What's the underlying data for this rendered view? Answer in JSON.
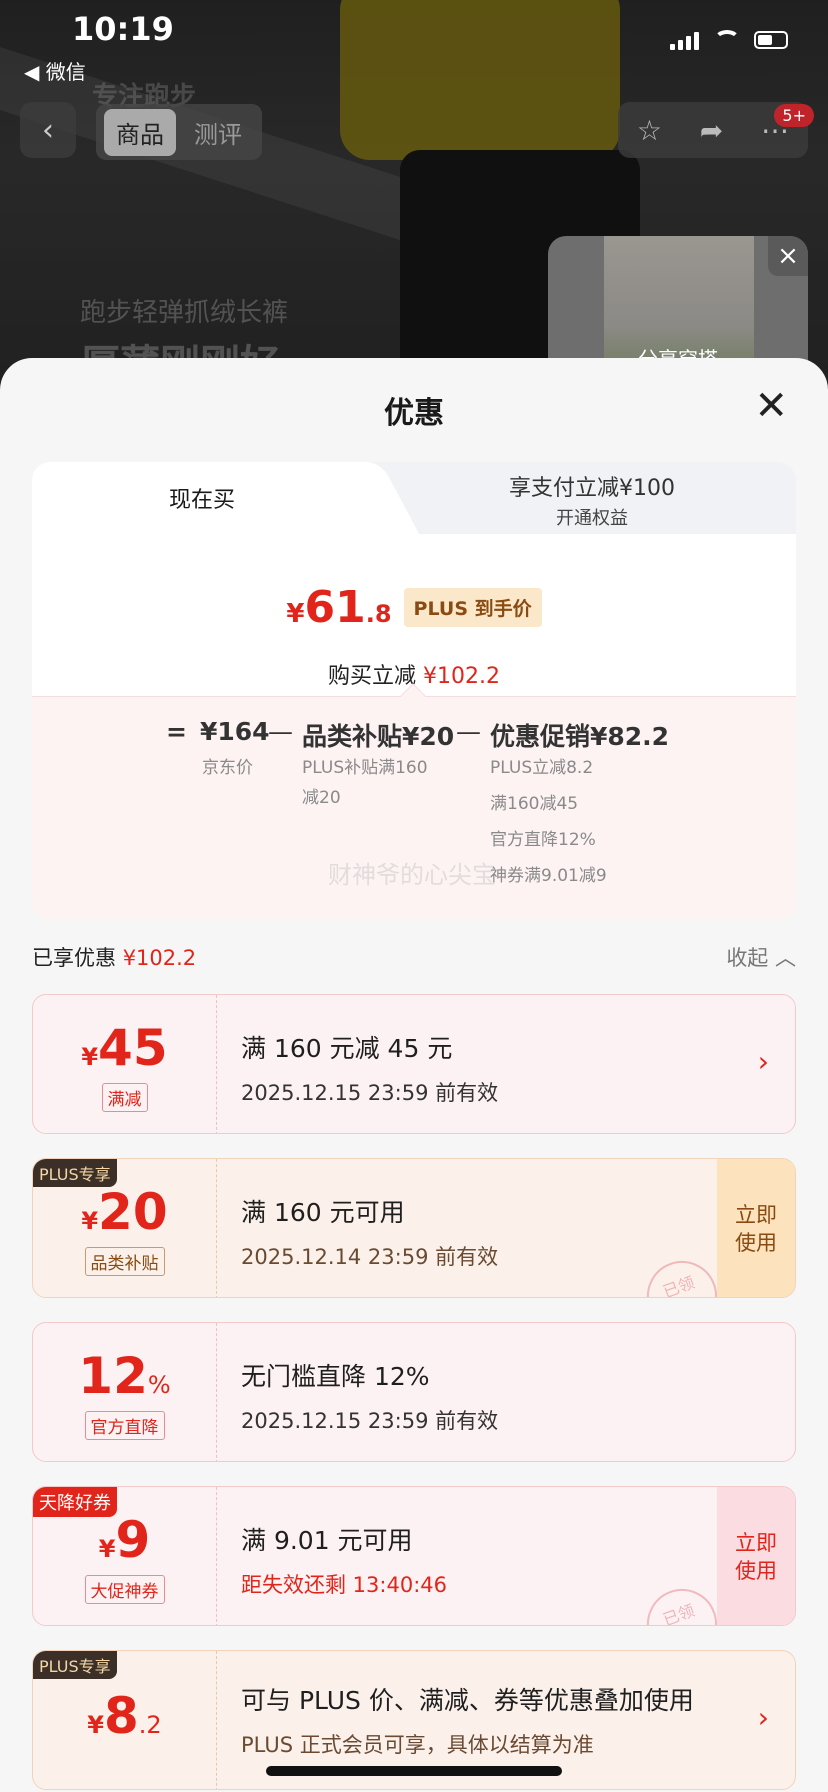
{
  "status_bar": {
    "time": "10:19",
    "back_app": "◀ 微信"
  },
  "background": {
    "brand": "专注跑步",
    "slogan_line1": "跑步轻弹抓绒长裤",
    "slogan_line2": "厚薄刚刚好"
  },
  "nav": {
    "tabs": [
      "商品",
      "测评"
    ],
    "badge": "5+"
  },
  "share_card": {
    "label": "分享穿搭"
  },
  "sheet": {
    "title": "优惠"
  },
  "price_card": {
    "tab_now": "现在买",
    "tab_pay_line1": "享支付立减¥100",
    "tab_pay_line2": "开通权益",
    "price_yen": "¥",
    "price_int": "61",
    "price_dec": ".8",
    "plus_tag": "PLUS 到手价",
    "reduce_label": "购买立减",
    "reduce_value": "¥102.2",
    "formula": {
      "equals": "=",
      "jd_price": "¥164",
      "jd_label": "京东价",
      "minus1": "—",
      "category": "品类补贴¥20",
      "category_sub": "PLUS补贴满160减20",
      "minus2": "—",
      "promo": "优惠促销¥82.2",
      "promo_sub": [
        "PLUS立减8.2",
        "满160减45",
        "官方直降12%",
        "神券满9.01减9"
      ]
    },
    "watermark": "财神爷的心尖宝"
  },
  "enjoyed": {
    "label": "已享优惠",
    "value": "¥102.2",
    "collapse": "收起"
  },
  "coupons": [
    {
      "yen": "¥",
      "num": "45",
      "unit": "",
      "kind": "满减",
      "cond": "满 160 元减 45 元",
      "valid": "2025.12.15 23:59 前有效"
    },
    {
      "tag": "PLUS专享",
      "yen": "¥",
      "num": "20",
      "unit": "",
      "kind": "品类补贴",
      "cond": "满 160 元可用",
      "valid": "2025.12.14 23:59 前有效",
      "use": "立即使用",
      "stamp": "已领"
    },
    {
      "yen": "",
      "num": "12",
      "unit": "%",
      "kind": "官方直降",
      "cond": "无门槛直降 12%",
      "valid": "2025.12.15 23:59 前有效"
    },
    {
      "tag": "天降好券",
      "yen": "¥",
      "num": "9",
      "unit": "",
      "kind": "大促神券",
      "cond": "满 9.01 元可用",
      "valid": "距失效还剩 13:40:46",
      "use": "立即使用",
      "stamp": "已领"
    },
    {
      "tag": "PLUS专享",
      "yen": "¥",
      "num": "8",
      "unit": ".2",
      "kind": "",
      "cond": "可与 PLUS 价、满减、券等优惠叠加使用",
      "valid": "PLUS 正式会员可享，具体以结算为准"
    }
  ],
  "colors": {
    "accent_red": "#e1251b",
    "plus_gold": "#8a4b12"
  }
}
